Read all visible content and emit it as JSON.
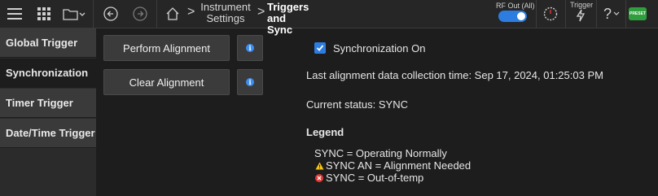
{
  "toolbar": {
    "breadcrumb": {
      "item1_line1": "Instrument",
      "item1_line2": "Settings",
      "item2_line1": "Triggers",
      "item2_line2": "and Sync",
      "separator": ">"
    },
    "rf_out_label": "RF Out (All)",
    "rf_out_on": true,
    "trigger_label": "Trigger",
    "help_glyph": "?",
    "preset_label": "PRESET"
  },
  "sidebar": {
    "items": [
      {
        "label": "Global Trigger"
      },
      {
        "label": "Synchronization",
        "active": true
      },
      {
        "label": "Timer Trigger"
      },
      {
        "label": "Date/Time Trigger"
      }
    ]
  },
  "main": {
    "perform_alignment_label": "Perform Alignment",
    "clear_alignment_label": "Clear Alignment",
    "info_glyph": "i",
    "sync_checkbox_label": "Synchronization On",
    "sync_checked": true,
    "last_alignment_text": "Last alignment data collection time: Sep 17, 2024, 01:25:03 PM",
    "current_status_text": "Current status: SYNC",
    "legend_title": "Legend",
    "legend_items": [
      {
        "icon": "none",
        "text": "SYNC = Operating Normally"
      },
      {
        "icon": "warning-icon",
        "text": "SYNC AN = Alignment Needed"
      },
      {
        "icon": "error-icon",
        "text": "SYNC = Out-of-temp"
      }
    ]
  },
  "colors": {
    "accent": "#2d7de0",
    "info": "#3d8ef0",
    "warning": "#f5c518",
    "error": "#e53935",
    "preset": "#2f9f3d"
  }
}
